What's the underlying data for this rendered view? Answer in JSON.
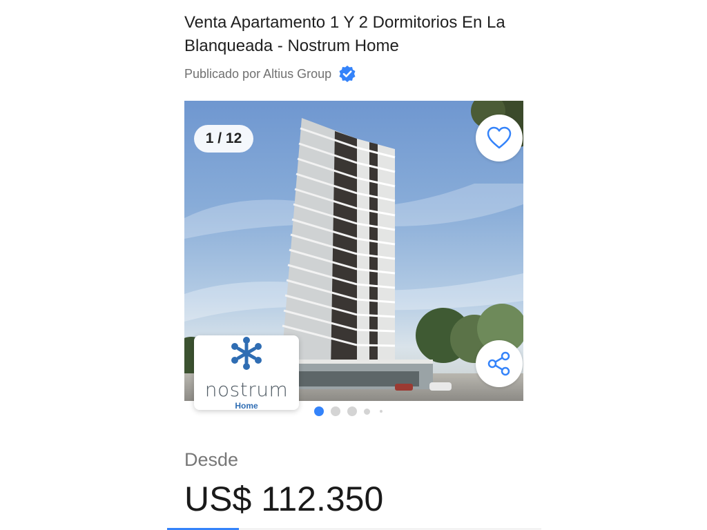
{
  "listing": {
    "title": "Venta Apartamento 1 Y 2 Dormitorios En La Blanqueada - Nostrum Home",
    "publisher": "Publicado por Altius Group",
    "verified_icon": "verified-badge-icon"
  },
  "gallery": {
    "counter": "1 / 12",
    "current_index": 1,
    "total": 12,
    "favorite_icon": "heart-icon",
    "share_icon": "share-icon",
    "dots_visible": 5,
    "active_dot": 0
  },
  "developer_logo": {
    "brand": "nostrum",
    "sub": "Home"
  },
  "price": {
    "prefix": "Desde",
    "currency": "US$",
    "amount": "112.350"
  },
  "colors": {
    "accent": "#3483fa",
    "logo_blue": "#2f6db3"
  }
}
